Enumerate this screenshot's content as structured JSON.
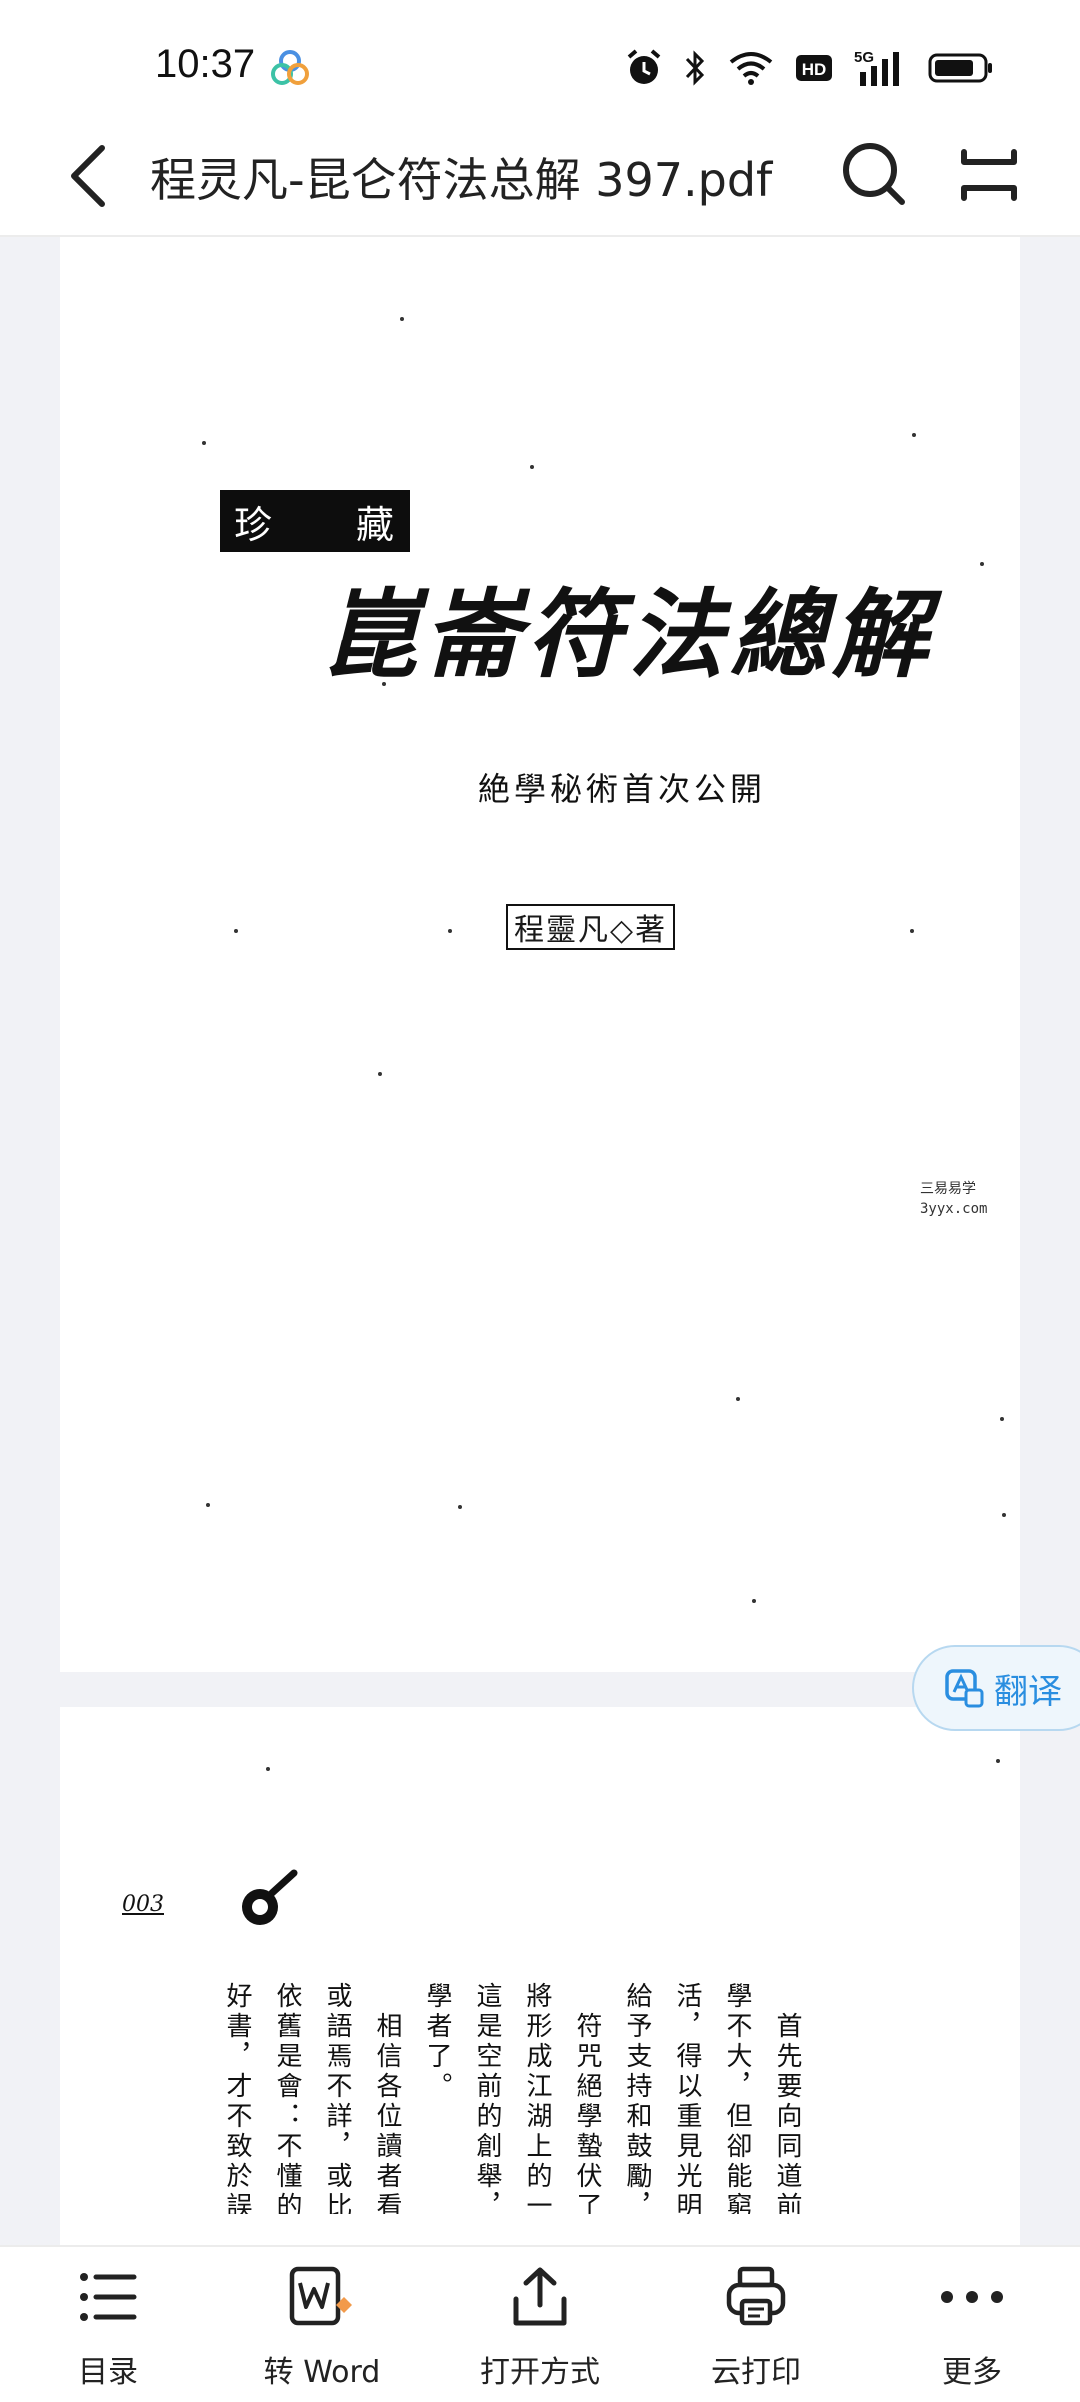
{
  "status_bar": {
    "time": "10:37",
    "app_icon": "cloud-rings-icon",
    "icons": [
      "alarm-icon",
      "bluetooth-icon",
      "wifi-icon",
      "hd-icon",
      "5g-signal-icon",
      "battery-icon"
    ],
    "network_label": "5G",
    "hd_label": "HD"
  },
  "header": {
    "back_icon": "chevron-left-icon",
    "title": "程灵凡-昆仑符法总解 397.pdf",
    "search_icon": "search-icon",
    "more_icon": "menu-icon"
  },
  "document": {
    "page1": {
      "stamp_left": "珍",
      "stamp_right": "藏",
      "title": "崑崙符法總解",
      "subtitle": "絶學秘術首次公開",
      "author": "程靈凡◇著",
      "watermark_line1": "三易易学",
      "watermark_line2": "3yyx.com"
    },
    "page2": {
      "page_number": "003",
      "columns": [
        "首先要向同道前先",
        "學不大，但卻能窮惡無",
        "活，得以重見光明。筆",
        "給予支持和鼓勵，本人",
        "符咒絕學蟄伏了幾",
        "將形成江湖上的一種秘",
        "這是空前的創舉，此一",
        "學者了。",
        "相信各位讀者看了",
        "或語焉不詳，或比較簡",
        "依舊是會：不懂的人看",
        "好書，才不致於誤入歧"
      ]
    }
  },
  "translate_button": {
    "label": "翻译",
    "icon": "translate-icon"
  },
  "toolbar": {
    "items": [
      {
        "label": "目录",
        "icon": "list-icon"
      },
      {
        "label": "转 Word",
        "icon": "word-convert-icon"
      },
      {
        "label": "打开方式",
        "icon": "share-icon"
      },
      {
        "label": "云打印",
        "icon": "printer-icon"
      },
      {
        "label": "更多",
        "icon": "more-dots-icon"
      }
    ]
  },
  "colors": {
    "accent": "#2a8ee0",
    "word_badge": "#f29a4a",
    "viewer_bg": "#f1f2f6"
  }
}
